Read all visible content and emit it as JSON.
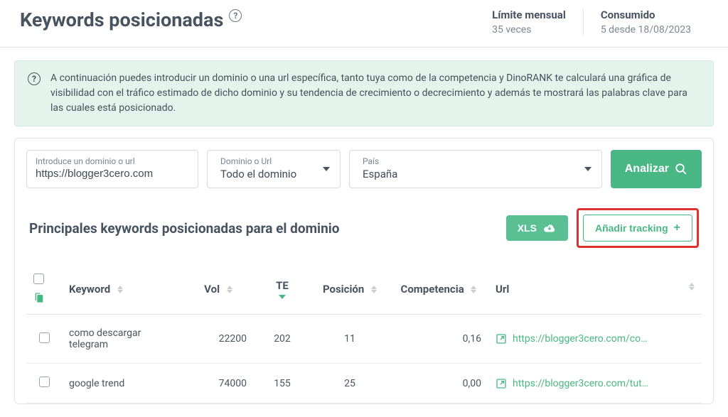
{
  "header": {
    "title": "Keywords posicionadas",
    "limit_label": "Límite mensual",
    "limit_value": "35 veces",
    "consumed_label": "Consumido",
    "consumed_value": "5 desde 18/08/2023"
  },
  "banner": {
    "text": "A continuación puedes introducir un dominio o una url específica, tanto tuya como de la competencia y DinoRANK te calculará una gráfica de visibilidad con el tráfico estimado de dicho dominio y su tendencia de crecimiento o decrecimiento y además te mostrará las palabras clave para las cuales está posicionado."
  },
  "controls": {
    "domain_label": "Introduce un dominio o url",
    "domain_value": "https://blogger3cero.com",
    "scope_label": "Dominio o Url",
    "scope_value": "Todo el dominio",
    "country_label": "País",
    "country_value": "España",
    "analyze_label": "Analizar"
  },
  "section": {
    "title": "Principales keywords posicionadas para el dominio",
    "xls_label": "XLS",
    "tracking_label": "Añadir tracking"
  },
  "columns": {
    "keyword": "Keyword",
    "vol": "Vol",
    "te": "TE",
    "posicion": "Posición",
    "competencia": "Competencia",
    "url": "Url"
  },
  "rows": [
    {
      "keyword": "como descargar telegram",
      "vol": "22200",
      "te": "202",
      "posicion": "11",
      "competencia": "0,16",
      "url": "https://blogger3cero.com/co…"
    },
    {
      "keyword": "google trend",
      "vol": "74000",
      "te": "155",
      "posicion": "25",
      "competencia": "0,00",
      "url": "https://blogger3cero.com/tut…"
    }
  ]
}
